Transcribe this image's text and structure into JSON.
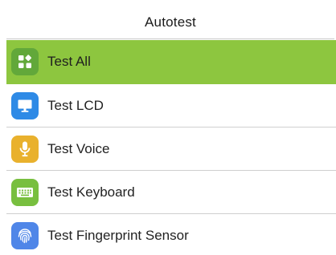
{
  "header": {
    "title": "Autotest"
  },
  "menu": {
    "selected_index": 0,
    "items": [
      {
        "label": "Test All",
        "icon": "apps-grid-icon",
        "icon_color": "#62a83a"
      },
      {
        "label": "Test LCD",
        "icon": "monitor-icon",
        "icon_color": "#2e8ae6"
      },
      {
        "label": "Test Voice",
        "icon": "microphone-icon",
        "icon_color": "#e9b12d"
      },
      {
        "label": "Test Keyboard",
        "icon": "keyboard-icon",
        "icon_color": "#78bf3f"
      },
      {
        "label": "Test Fingerprint Sensor",
        "icon": "fingerprint-icon",
        "icon_color": "#4f86e8"
      }
    ]
  },
  "colors": {
    "selected_row": "#8dc63f",
    "divider": "#cfcfcf"
  }
}
